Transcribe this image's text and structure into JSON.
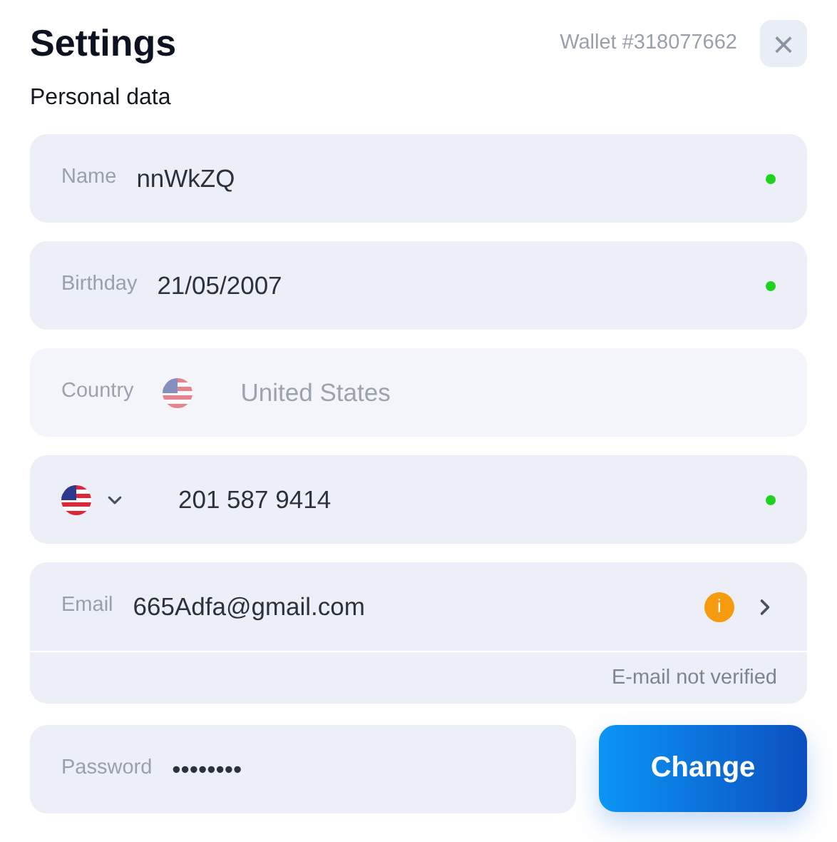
{
  "title": "Settings",
  "wallet": "Wallet #318077662",
  "close": "×",
  "section": "Personal data",
  "fields": [
    {
      "kind": "text",
      "label": "Name",
      "value": "nnWkZQ",
      "verified": true,
      "disabled": false
    },
    {
      "kind": "text",
      "label": "Birthday",
      "value": "21/05/2007",
      "verified": true,
      "disabled": false
    },
    {
      "kind": "country",
      "label": "Country",
      "value": "United States",
      "disabled": true
    },
    {
      "kind": "phone",
      "value": "201 587 9414",
      "verified": true,
      "disabled": false
    },
    {
      "kind": "email",
      "label": "Email",
      "value": "665Adfa@gmail.com",
      "verified": false,
      "disabled": false,
      "warning_icon": "i",
      "note": "E-mail not verified"
    }
  ],
  "password": {
    "label": "Password",
    "value": "••••••••"
  },
  "change_button": "Change"
}
